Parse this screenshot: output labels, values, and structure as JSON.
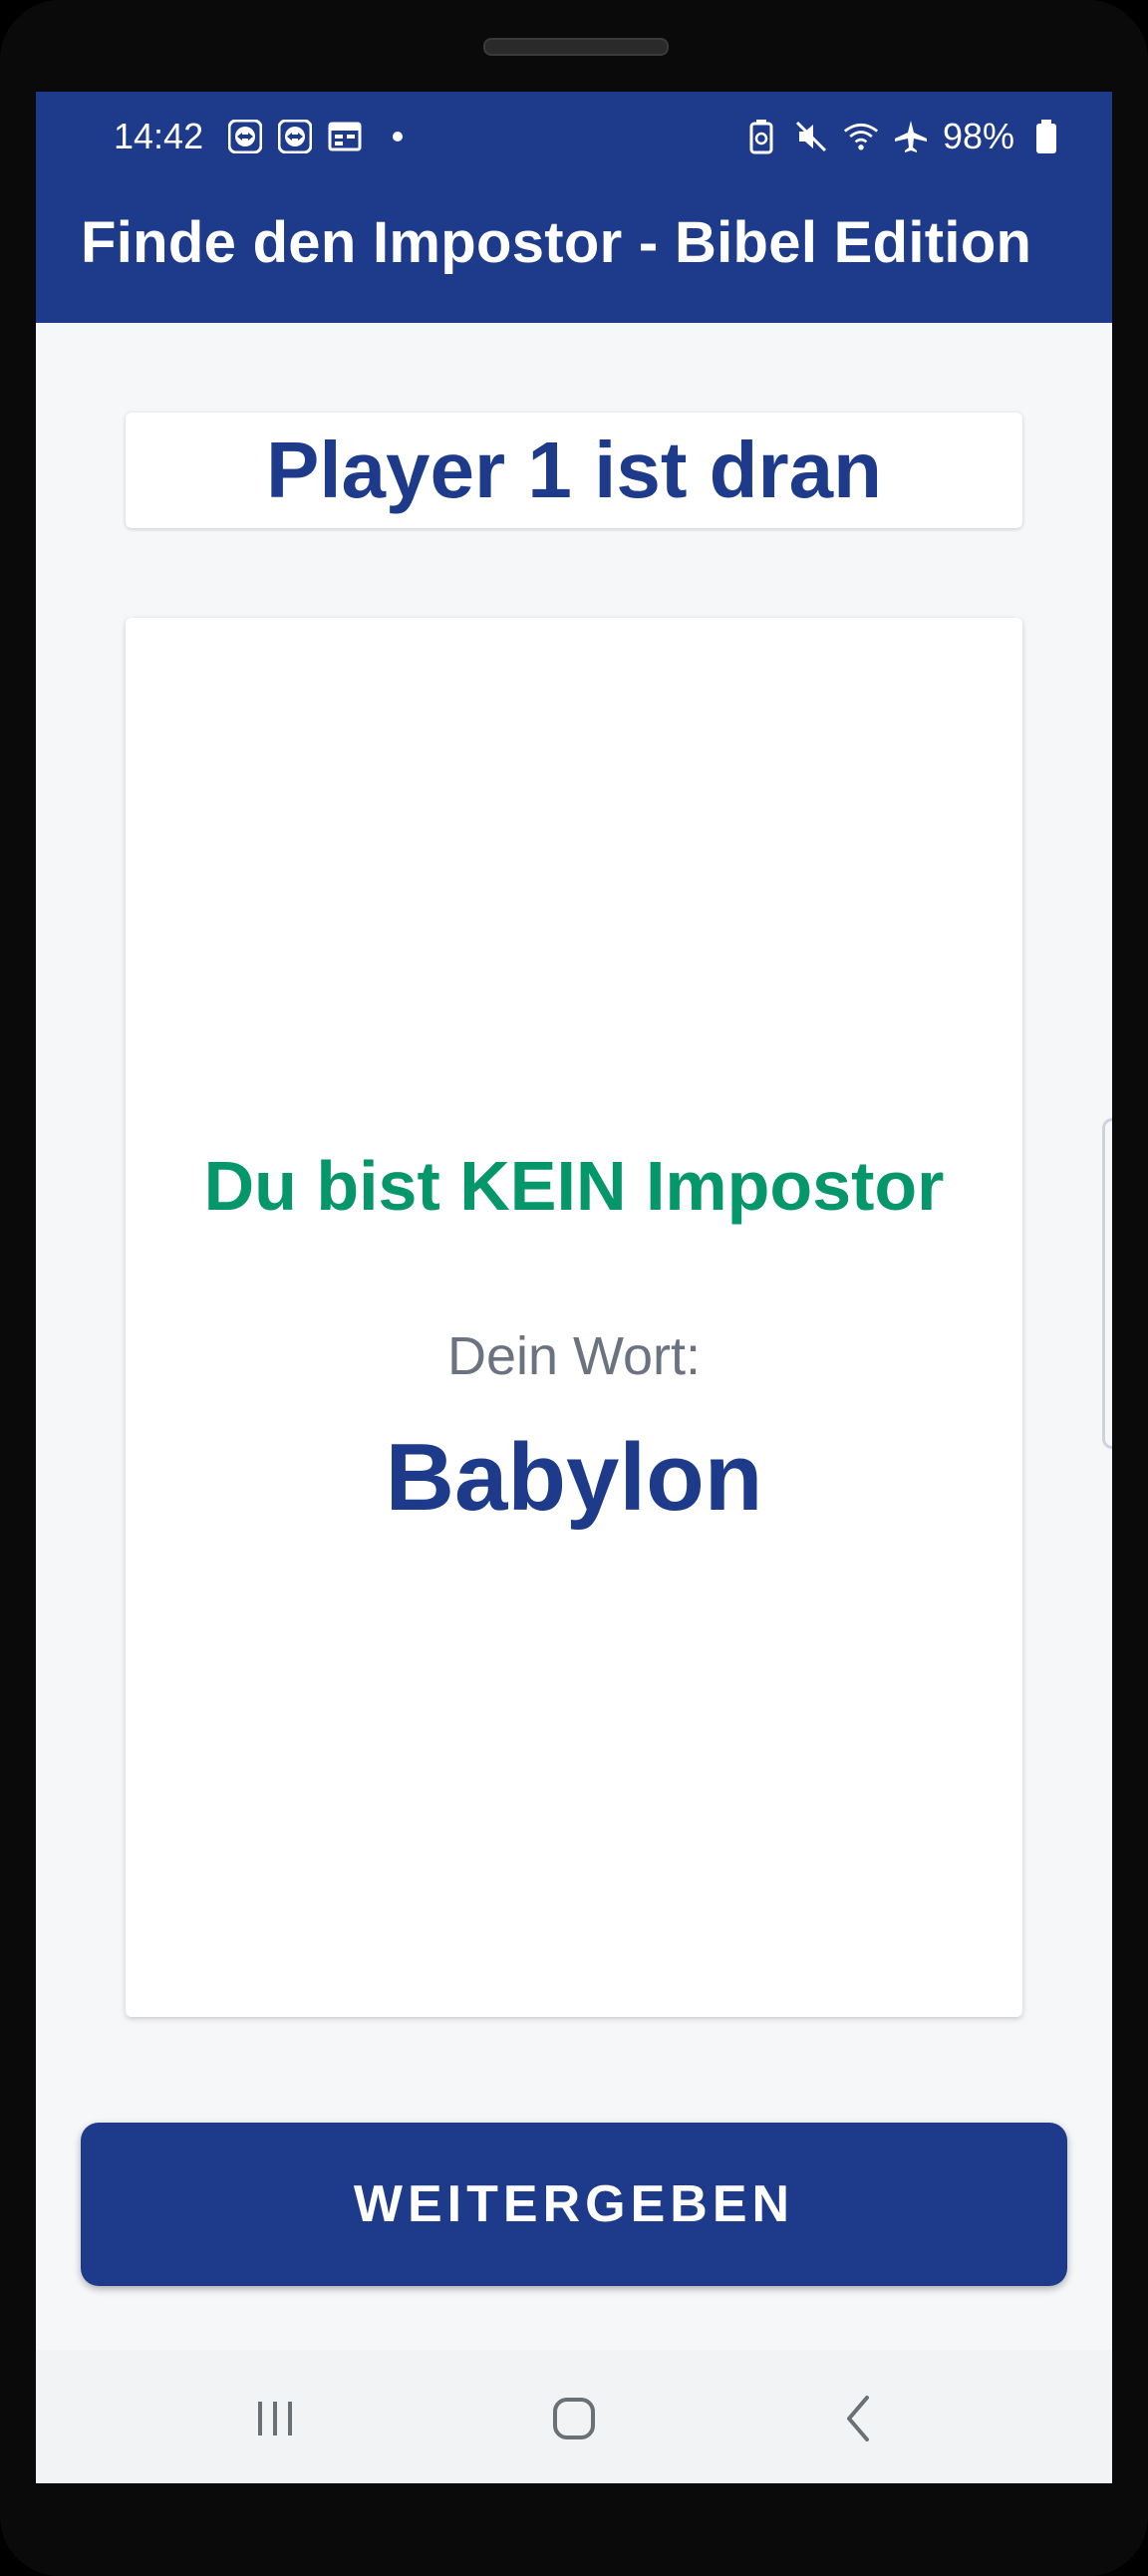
{
  "status_bar": {
    "time": "14:42",
    "battery": "98%",
    "left_icons": [
      "teamviewer-icon",
      "teamviewer-icon",
      "calendar-icon"
    ],
    "right_icons": [
      "battery-saver-icon",
      "mute-icon",
      "wifi-icon",
      "airplane-icon",
      "battery-icon"
    ]
  },
  "app_bar": {
    "title": "Finde den Impostor - Bibel Edition"
  },
  "player": {
    "turn_label": "Player 1 ist dran"
  },
  "card": {
    "role_text": "Du bist KEIN Impostor",
    "word_label": "Dein Wort:",
    "word": "Babylon"
  },
  "actions": {
    "pass_label": "WEITERGEBEN"
  },
  "colors": {
    "primary": "#1e3a8a",
    "success": "#059669",
    "muted": "#6b7280"
  }
}
